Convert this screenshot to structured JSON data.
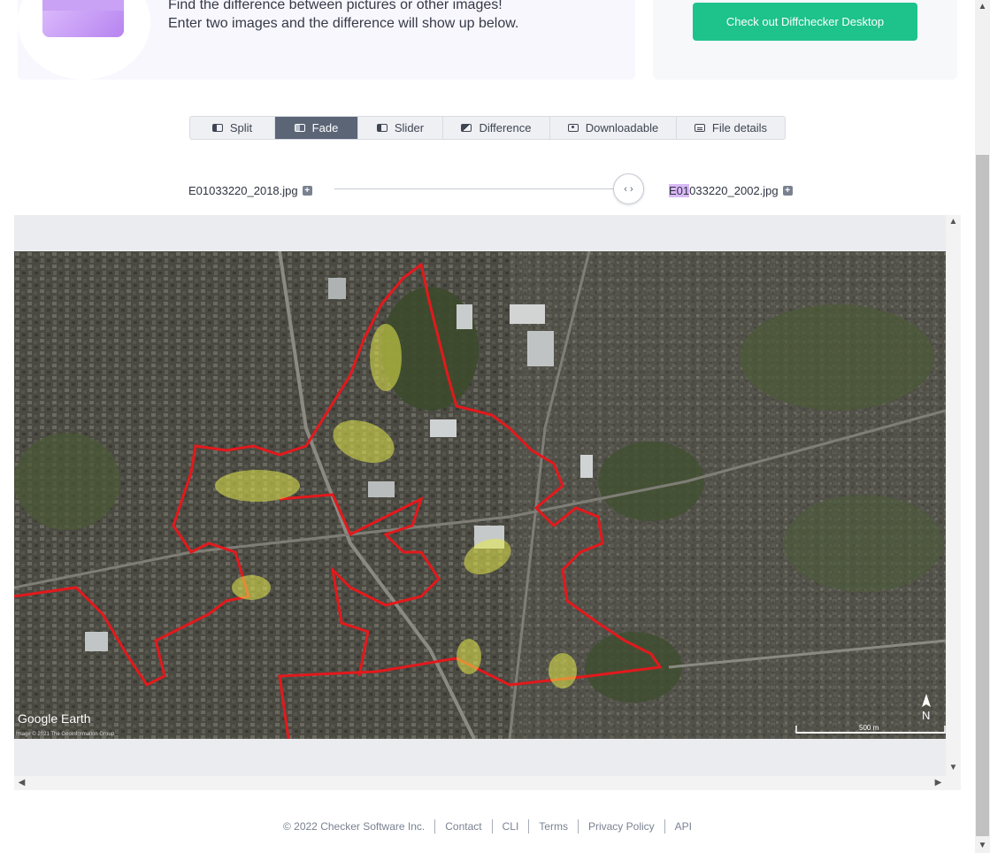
{
  "hero": {
    "line1": "Find the difference between pictures or other images!",
    "line2": "Enter two images and the difference will show up below."
  },
  "promo": {
    "button_label": "Check out Diffchecker Desktop"
  },
  "tabs": [
    {
      "label": "Split",
      "icon": "split-view-icon",
      "active": false
    },
    {
      "label": "Fade",
      "icon": "fade-view-icon",
      "active": true
    },
    {
      "label": "Slider",
      "icon": "slider-view-icon",
      "active": false
    },
    {
      "label": "Difference",
      "icon": "difference-view-icon",
      "active": false
    },
    {
      "label": "Downloadable",
      "icon": "image-download-icon",
      "active": false
    },
    {
      "label": "File details",
      "icon": "file-details-icon",
      "active": false
    }
  ],
  "files": {
    "left": "E01033220_2018.jpg",
    "right_highlight": "E01",
    "right_rest": "033220_2002.jpg"
  },
  "fade_slider": {
    "value": 0.95
  },
  "map": {
    "watermark": "Google Earth",
    "credit": "Image © 2021 The GeoInformation Group",
    "scale_label": "500 m",
    "north_label": "N"
  },
  "footer": {
    "copyright": "© 2022 Checker Software Inc.",
    "links": [
      "Contact",
      "CLI",
      "Terms",
      "Privacy Policy",
      "API"
    ]
  },
  "colors": {
    "accent_green": "#1ec28b",
    "active_tab": "#5b6576",
    "boundary_red": "#e3191c",
    "highlight_yellow": "#e6e94a",
    "filename_highlight": "#d9b8f7"
  }
}
